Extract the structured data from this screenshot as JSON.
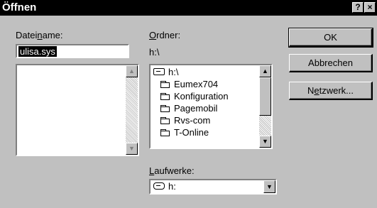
{
  "dialog": {
    "title": "Öffnen",
    "help_button": "?",
    "close_button": "×"
  },
  "filename": {
    "label_pre": "Datei",
    "label_accel": "n",
    "label_post": "ame:",
    "value": "ulisa.sys"
  },
  "folder": {
    "label_accel": "O",
    "label_post": "rdner:",
    "current_path": "h:\\",
    "items": [
      {
        "name": "h:\\",
        "icon": "open-folder-icon"
      },
      {
        "name": "Eumex704",
        "icon": "folder-icon"
      },
      {
        "name": "Konfiguration",
        "icon": "folder-icon"
      },
      {
        "name": "Pagemobil",
        "icon": "folder-icon"
      },
      {
        "name": "Rvs-com",
        "icon": "folder-icon"
      },
      {
        "name": "T-Online",
        "icon": "folder-icon"
      }
    ]
  },
  "drives": {
    "label_accel": "L",
    "label_post": "aufwerke:",
    "selected": "h:",
    "icon": "drive-icon"
  },
  "buttons": {
    "ok": "OK",
    "cancel": "Abbrechen",
    "network_pre": "N",
    "network_accel": "e",
    "network_post": "tzwerk..."
  },
  "scroll_arrows": {
    "up": "▲",
    "down": "▼"
  }
}
